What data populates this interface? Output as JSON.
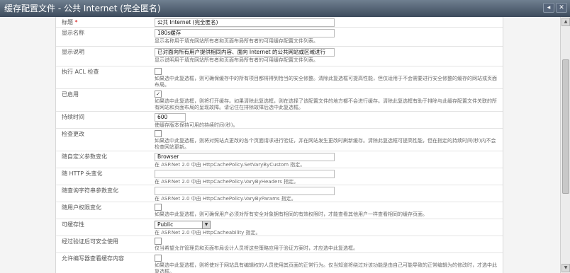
{
  "window": {
    "title": "缓存配置文件 - 公共 Internet (完全匿名)",
    "controls": [
      "◂",
      "✕"
    ]
  },
  "form": {
    "title_field": {
      "label": "标题",
      "required_mark": "*",
      "value": "公共 Internet (完全匿名)"
    },
    "display_name": {
      "label": "显示名称",
      "value": "180s缓存",
      "description": "显示名称用于填充网站所有者和页面布局所有者的可用缓存配置文件列表。"
    },
    "display_description": {
      "label": "显示说明",
      "value": "已对面向所有用户提供相同内容、面向 Internet 的公共网站或区域进行",
      "description": "显示说明用于填充网站所有者和页面布局所有者的可用缓存配置文件列表。"
    },
    "acl_check": {
      "label": "执行 ACL 检查",
      "checked": false,
      "description": "如果选中此复选框，则可确保缓存中的所有项目都将得到恰当的安全修整。清除此复选框可提高性能，但仅适用于不会需要进行安全修整的缓存的网站或页面布局。"
    },
    "enabled": {
      "label": "已启用",
      "checked": true,
      "check_glyph": "✓",
      "description": "如果选中此复选框，则将打开缓存。如果清除此复选框，则在选择了该配置文件的地方都不会进行缓存。清除此复选框有助于排除与此缓存配置文件关联的所有网站和页面布局的呈现故障。请记住在排除故障后选中此复选框。"
    },
    "duration": {
      "label": "持续时间",
      "value": "600",
      "description": "使缓存版本保持可用的持续时间(秒)。"
    },
    "check_changes": {
      "label": "检查更改",
      "checked": false,
      "description": "如果选中此复选框，则将对照站点更改的各个页面请求进行验证，并在网站发生更改时刷新缓存。清除此复选框可提高性能，但在指定的持续时间(秒)内不会检查网站更新。"
    },
    "vary_custom": {
      "label": "随自定义参数变化",
      "value": "Browser",
      "description": "在 ASP.Net 2.0 中由 HttpCachePolicy.SetVaryByCustom 指定。"
    },
    "vary_http_header": {
      "label": "随 HTTP 头变化",
      "value": "",
      "description": "在 ASP.Net 2.0 中由 HttpCachePolicy.VaryByHeaders 指定。"
    },
    "vary_query_string": {
      "label": "随查询字符串参数变化",
      "value": "",
      "description": "在 ASP.Net 2.0 中由 HttpCachePolicy.VaryByParams 指定。"
    },
    "vary_user_rights": {
      "label": "随用户权限变化",
      "checked": false,
      "description": "如果选中此复选框，则可确保用户必须对所有安全对象拥有相同的有效权限时，才能查看其他用户一样查看相同的缓存页面。"
    },
    "cacheability": {
      "label": "可缓存性",
      "selected": "Public",
      "arrow": "▼",
      "description": "在 ASP.Net 2.0 中由 HttpCacheability 指定。"
    },
    "safe_for_authenticated": {
      "label": "经过验证后可安全使用",
      "checked": false,
      "description": "仅当希望允许管理员和页面布局设计人员将这些策略应用于验证方案时，才应选中此复选框。"
    },
    "allow_writers_cached": {
      "label": "允许编写器查看缓存内容",
      "checked": false,
      "description": "如果选中此复选框，则将使对于网站具有编辑权的人员使用其页面的正常行为。仅当知道将绕过对该功能是由自己可能导致的正常编辑为的修改时，才选中此复选框。"
    }
  },
  "scrollbar": {
    "up_arrow": "▲",
    "down_arrow": "▼"
  }
}
